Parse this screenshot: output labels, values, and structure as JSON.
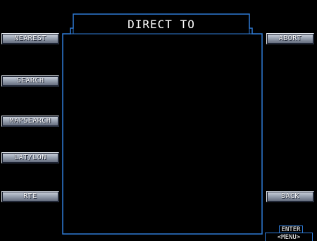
{
  "window": {
    "title": "DIRECT TO"
  },
  "left_softkeys": [
    {
      "label": "NEAREST"
    },
    {
      "label": "SEARCH"
    },
    {
      "label": "MAPSEARCH"
    },
    {
      "label": "LAT/LON"
    },
    {
      "label": "RTE"
    }
  ],
  "right_softkeys": [
    {
      "label": "ABORT"
    },
    {
      "label": "BACK"
    }
  ],
  "bottom_right": {
    "enter_label": "ENTER",
    "menu_label": "<MENU>"
  },
  "colors": {
    "background": "#000000",
    "frame": "#2f7bd6",
    "text": "#ffffff",
    "button_face": "#9aa3b2"
  }
}
